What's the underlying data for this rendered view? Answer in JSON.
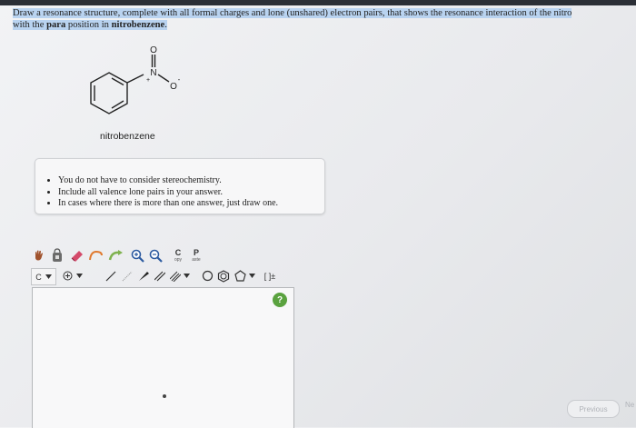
{
  "question": {
    "line1": "Draw a resonance structure, complete with all formal charges and lone (unshared) electron pairs, that shows the resonance interaction of the nitro",
    "line2_prefix": "with the ",
    "line2_bold1": "para",
    "line2_middle": " position in ",
    "line2_bold2": "nitrobenzene",
    "line2_suffix": "."
  },
  "molecule": {
    "label": "nitrobenzene",
    "atom_O_top": "O",
    "atom_N": "N",
    "charge_plus": "+",
    "atom_O_right": "O",
    "charge_minus": "-"
  },
  "notes": {
    "items": [
      "You do not have to consider stereochemistry.",
      "Include all valence lone pairs in your answer.",
      "In cases where there is more than one answer, just draw one."
    ]
  },
  "toolbar": {
    "copy_letter": "C",
    "copy_sub": "opy",
    "paste_letter": "P",
    "paste_sub": "aste",
    "element_label": "C",
    "bracket_label": "[ ]±"
  },
  "colors": {
    "highlight": "#b9d3f0",
    "help_green": "#5aa23f"
  },
  "nav": {
    "help": "?",
    "previous": "Previous",
    "next": "Ne"
  }
}
